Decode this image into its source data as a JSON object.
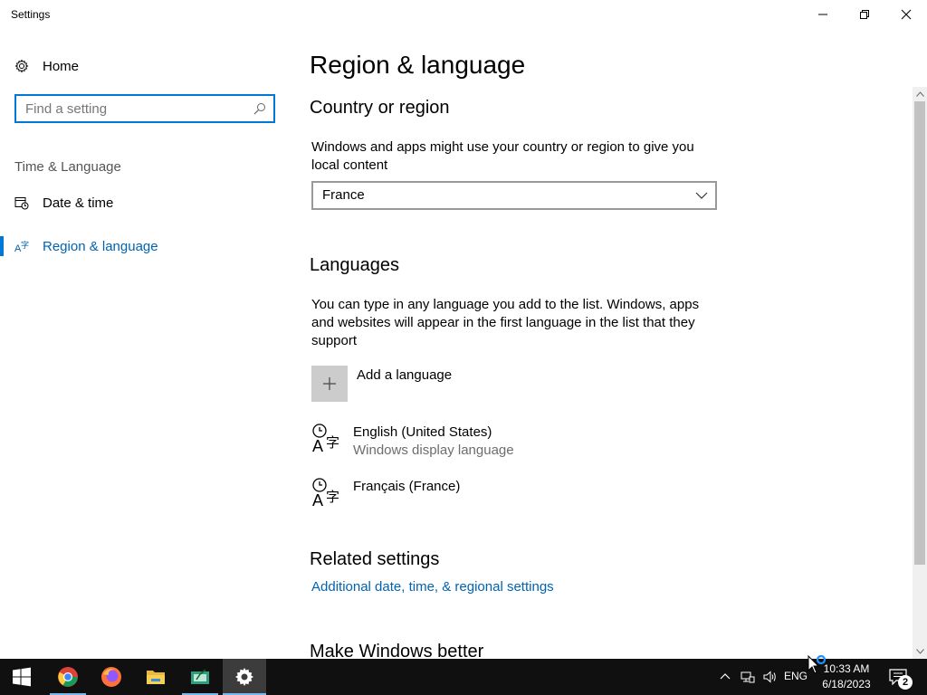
{
  "window": {
    "title": "Settings",
    "controls": {
      "minimize": "minimize-icon",
      "maximize": "restore-icon",
      "close": "close-icon"
    }
  },
  "sidebar": {
    "home_label": "Home",
    "search": {
      "placeholder": "Find a setting",
      "value": ""
    },
    "section_label": "Time & Language",
    "items": [
      {
        "label": "Date & time",
        "icon": "date-time-icon",
        "selected": false
      },
      {
        "label": "Region & language",
        "icon": "region-language-icon",
        "selected": true
      }
    ]
  },
  "main": {
    "title": "Region & language",
    "country": {
      "heading": "Country or region",
      "description": "Windows and apps might use your country or region to give you local content",
      "selected": "France"
    },
    "languages": {
      "heading": "Languages",
      "description": "You can type in any language you add to the list. Windows, apps and websites will appear in the first language in the list that they support",
      "add_label": "Add a language",
      "list": [
        {
          "name": "English (United States)",
          "subtitle": "Windows display language"
        },
        {
          "name": "Français (France)",
          "subtitle": ""
        }
      ]
    },
    "related": {
      "heading": "Related settings",
      "link": "Additional date, time, & regional settings"
    },
    "make_better_heading": "Make Windows better"
  },
  "taskbar": {
    "apps": [
      "start",
      "chrome",
      "firefox",
      "file-explorer",
      "app",
      "settings"
    ],
    "active_app": "settings",
    "language": "ENG",
    "time": "10:33 AM",
    "date": "6/18/2023",
    "notification_count": "2"
  },
  "colors": {
    "accent": "#0078d7",
    "link": "#0063b1",
    "taskbar": "#101010"
  }
}
